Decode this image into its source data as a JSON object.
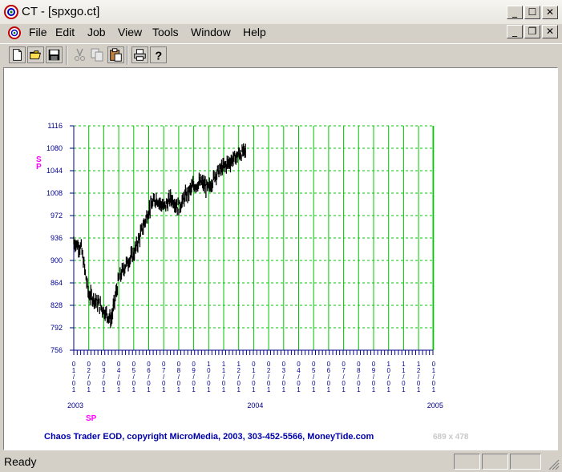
{
  "window": {
    "title": "CT - [spxgo.ct]"
  },
  "window_buttons": {
    "minimize": "_",
    "maximize": "☐",
    "close": "✕"
  },
  "doc_buttons": {
    "minimize": "_",
    "restore": "❐",
    "close": "✕"
  },
  "menu": {
    "items": [
      "File",
      "Edit",
      "Job",
      "View",
      "Tools",
      "Window",
      "Help"
    ]
  },
  "toolbar": {
    "buttons": [
      "new-icon",
      "open-icon",
      "save-icon",
      "cut-icon",
      "copy-icon",
      "paste-icon",
      "print-icon",
      "help-icon"
    ]
  },
  "chart_data": {
    "type": "ohlc",
    "symbol_label": "SP",
    "symbol_label_vertical": [
      "S",
      "P"
    ],
    "y_ticks": [
      756,
      792,
      828,
      864,
      900,
      936,
      972,
      1008,
      1044,
      1080,
      1116
    ],
    "ylim": [
      756,
      1116
    ],
    "month_labels": [
      "01/01",
      "02/01",
      "03/01",
      "04/01",
      "05/01",
      "06/01",
      "07/01",
      "08/01",
      "09/01",
      "10/01",
      "11/01",
      "12/01",
      "01/01",
      "02/01",
      "03/01",
      "04/01",
      "05/01",
      "06/01",
      "07/01",
      "08/01",
      "09/01",
      "10/01",
      "11/01",
      "12/01",
      "01/01"
    ],
    "year_labels": [
      "2003",
      "2004",
      "2005"
    ],
    "grid": true,
    "grid_color": "#00c800",
    "price_color": "#000000",
    "series": [
      {
        "month": 0,
        "close": 930
      },
      {
        "month": 0.5,
        "close": 920
      },
      {
        "month": 1,
        "close": 845
      },
      {
        "month": 1.5,
        "close": 835
      },
      {
        "month": 2,
        "close": 820
      },
      {
        "month": 2.5,
        "close": 805
      },
      {
        "month": 3,
        "close": 870
      },
      {
        "month": 3.5,
        "close": 895
      },
      {
        "month": 4,
        "close": 910
      },
      {
        "month": 4.5,
        "close": 945
      },
      {
        "month": 5,
        "close": 980
      },
      {
        "month": 5.5,
        "close": 1000
      },
      {
        "month": 6,
        "close": 985
      },
      {
        "month": 6.5,
        "close": 1000
      },
      {
        "month": 7,
        "close": 985
      },
      {
        "month": 7.5,
        "close": 1005
      },
      {
        "month": 8,
        "close": 1020
      },
      {
        "month": 8.5,
        "close": 1025
      },
      {
        "month": 9,
        "close": 1015
      },
      {
        "month": 9.5,
        "close": 1040
      },
      {
        "month": 10,
        "close": 1050
      },
      {
        "month": 10.5,
        "close": 1060
      },
      {
        "month": 11,
        "close": 1070
      },
      {
        "month": 11.5,
        "close": 1075
      }
    ]
  },
  "copyright": "Chaos Trader EOD, copyright MicroMedia, 2003, 303-452-5566, MoneyTide.com",
  "dimensions_label": "689 x 478",
  "status": {
    "text": "Ready"
  },
  "colors": {
    "axis_label": "#00008b",
    "symbol": "#ff00ff",
    "copyright": "#0000aa",
    "dimensions": "#c0c0c0"
  }
}
